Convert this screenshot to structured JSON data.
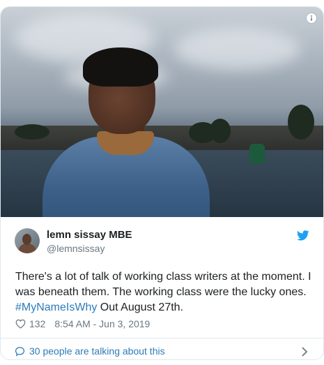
{
  "media": {
    "alt_icon": "info-icon"
  },
  "tweet": {
    "author_name": "lemn sissay MBE",
    "author_handle": "@lemnsissay",
    "text_before": "There's a lot of talk of working class writers at the moment. I was beneath them. The working class were the lucky ones.   ",
    "hashtag": "#MyNameIsWhy",
    "text_after": "  Out August 27th.",
    "likes": "132",
    "timestamp": "8:54 AM - Jun 3, 2019",
    "talking": "30 people are talking about this"
  },
  "colors": {
    "link": "#2b7bb9",
    "twitter_blue": "#1da1f2",
    "muted": "#697882"
  }
}
